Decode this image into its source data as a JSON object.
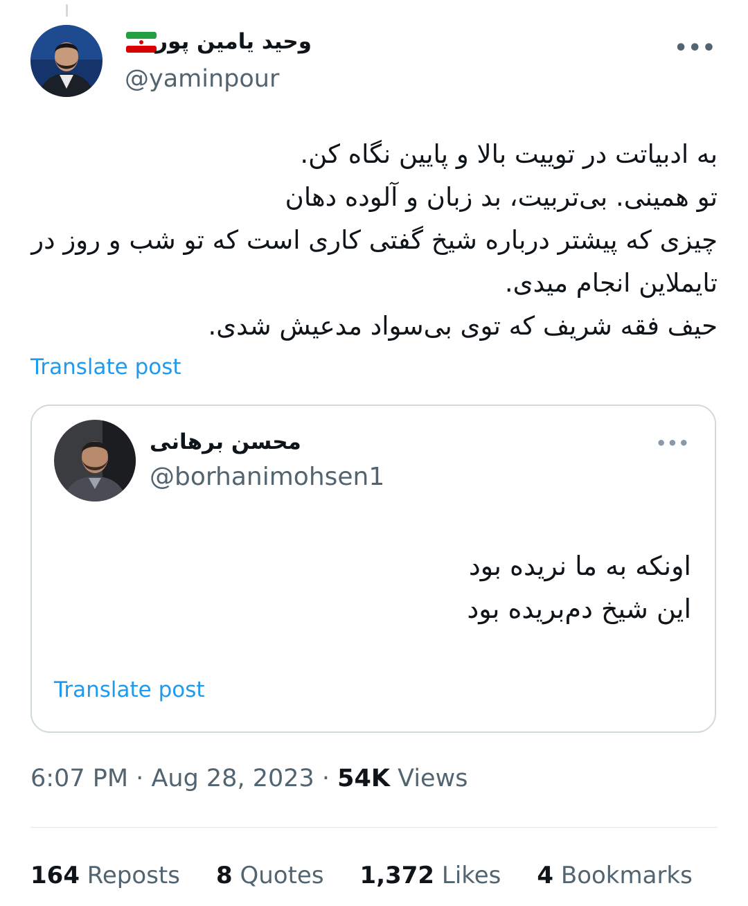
{
  "author": {
    "display_name": "وحید یامین پور",
    "handle": "@yaminpour"
  },
  "tweet": {
    "lines": [
      "به ادبیاتت در توییت بالا و پایین نگاه کن.",
      "تو همینی. بی‌تربیت، بد زبان و آلوده دهان",
      "چیزی که پیشتر درباره شیخ گفتی کاری است که تو شب و روز در",
      "تایملاین انجام میدی.",
      "حیف فقه شریف که توی بی‌سواد مدعیش شدی."
    ],
    "translate_label": "Translate post"
  },
  "quoted": {
    "display_name": "محسن برهانی",
    "handle": "@borhanimohsen1",
    "lines": [
      "اونکه به ما نریده بود",
      "این شیخ دم‌بریده بود"
    ],
    "translate_label": "Translate post"
  },
  "meta": {
    "time": "6:07 PM",
    "date": "Aug 28, 2023",
    "views_count": "54K",
    "views_label": "Views"
  },
  "stats": {
    "reposts_count": "164",
    "reposts_label": "Reposts",
    "quotes_count": "8",
    "quotes_label": "Quotes",
    "likes_count": "1,372",
    "likes_label": "Likes",
    "bookmarks_count": "4",
    "bookmarks_label": "Bookmarks"
  },
  "icons": {
    "more": "more-dots-icon",
    "flag": "iran-flag-icon"
  },
  "colors": {
    "link": "#1d9bf0",
    "secondary": "#536471",
    "text": "#0f1419",
    "border": "#cfd9de"
  }
}
